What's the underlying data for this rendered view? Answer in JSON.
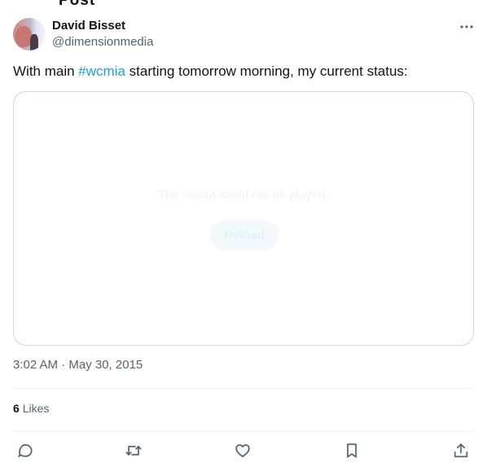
{
  "header_cut": "Post",
  "author": {
    "name": "David Bisset",
    "handle": "@dimensionmedia"
  },
  "tweet": {
    "text_before": "With main ",
    "hashtag": "#wcmia",
    "text_after": " starting tomorrow morning, my current status:"
  },
  "media": {
    "message": "The media could not be played.",
    "reload_label": "Reload"
  },
  "timestamp": "3:02 AM · May 30, 2015",
  "stats": {
    "likes_count": "6",
    "likes_label": "Likes"
  },
  "icons": {
    "more": "more-icon",
    "reply": "reply-icon",
    "retweet": "retweet-icon",
    "like": "like-icon",
    "bookmark": "bookmark-icon",
    "share": "share-icon"
  },
  "colors": {
    "accent": "#1d9bf0",
    "text": "#0f1419",
    "secondary": "#536471",
    "border": "#cfd9de"
  }
}
